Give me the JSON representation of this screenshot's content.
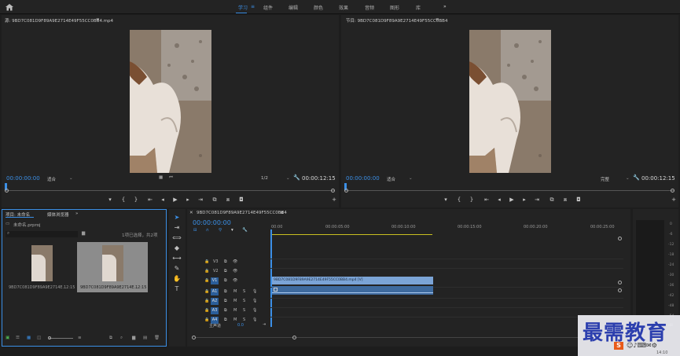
{
  "workspaces": [
    "学习",
    "组件",
    "编辑",
    "颜色",
    "效果",
    "音频",
    "图形",
    "库"
  ],
  "active_workspace": "学习",
  "more": "»",
  "source": {
    "title": "源: 9BD7C081D9F89A9E2714E49F55CC0BB4.mp4",
    "timecode_in": "00:00:00:00",
    "fit": "适合",
    "quality": "1/2",
    "duration": "00:00:12:15"
  },
  "program": {
    "title": "节目: 9BD7C081D9F89A9E2714E49F55CC0BB4",
    "timecode_in": "00:00:00:00",
    "fit": "适合",
    "quality": "完整",
    "duration": "00:00:12:15"
  },
  "project": {
    "tab_project": "项目: 未命名",
    "tab_media_browser": "媒体浏览器",
    "more": "»",
    "file_name": "未命名.prproj",
    "selection_info": "1项已选择，共2项",
    "items": [
      {
        "name": "9BD7C081D9F89A9E2714E...",
        "duration": "12:15"
      },
      {
        "name": "9BD7C081D9F89A9E2714E...",
        "duration": "12:15"
      }
    ]
  },
  "timeline": {
    "sequence_tab": "9BD7C081D9F89A9E2714E49F55CC0BB4",
    "timecode": "00:00:00:00",
    "ruler": [
      "00:00",
      "00:00:05:00",
      "00:00:10:00",
      "00:00:15:00",
      "00:00:20:00",
      "00:00:25:00"
    ],
    "video_tracks": [
      "V3",
      "V2",
      "V1"
    ],
    "audio_tracks": [
      "A1",
      "A2",
      "A3",
      "A4"
    ],
    "master_label": "主声道",
    "master_value": "0.0",
    "clip_label": "9BD7C081D9F89A9E2714E49F55CC0BB4.mp4 [V]"
  },
  "meter_ticks": [
    "0",
    "-6",
    "-12",
    "-18",
    "-24",
    "-30",
    "-36",
    "-42",
    "-48",
    "-54"
  ],
  "meter_db": "dB",
  "watermark": "最需教育",
  "clock": "14:10",
  "ime": "S"
}
